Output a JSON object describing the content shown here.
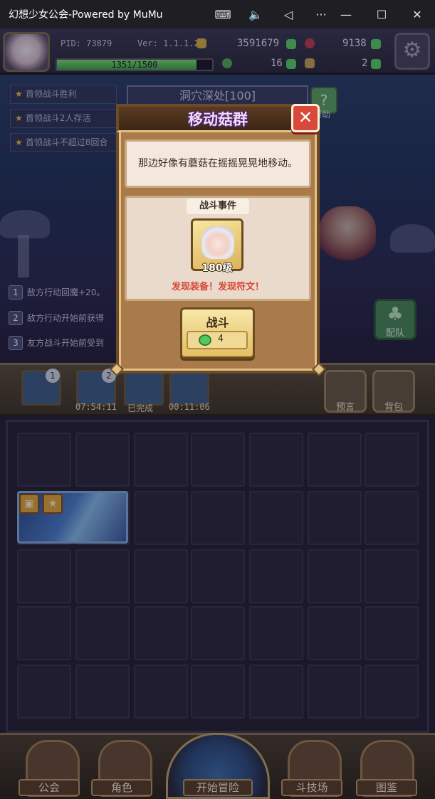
{
  "window": {
    "title": "幻想少女公会-Powered by MuMu",
    "icons": [
      "keyboard-icon",
      "volume-icon",
      "back-icon",
      "more-icon"
    ],
    "controls": [
      "minimize-icon",
      "maximize-icon",
      "close-icon"
    ]
  },
  "hud": {
    "pid": "PID: 73879",
    "version": "Ver: 1.1.1.2",
    "gold": "3591679",
    "gems": "9138",
    "clovers": "16",
    "keys": "2",
    "xp": {
      "text": "1351/1500",
      "fraction": 0.9
    }
  },
  "scene": {
    "goals": [
      "首领战斗胜利",
      "首领战斗2人存活",
      "首领战斗不超过8回合"
    ],
    "dungeon_name": "洞穴深处[100]",
    "help_label": "帮助",
    "rules": [
      {
        "num": "1",
        "text": "敌方行动回魔+20。"
      },
      {
        "num": "2",
        "text": "敌方行动开始前获得"
      },
      {
        "num": "3",
        "text": "友方战斗开始前受到"
      }
    ],
    "team_label": "配队"
  },
  "tray": {
    "slots": [
      {
        "badge": "1",
        "time": ""
      },
      {
        "badge": "2",
        "time": "07:54:11"
      },
      {
        "badge": "",
        "time": "已完成"
      },
      {
        "badge": "",
        "time": "00:11:06"
      }
    ],
    "prophecy_label": "预言",
    "bag_label": "背包"
  },
  "nav": {
    "guild": "公会",
    "character": "角色",
    "adventure": "开始冒险",
    "arena": "斗技场",
    "codex": "图鉴"
  },
  "modal": {
    "title": "移动菇群",
    "close": "✕",
    "description": "那边好像有蘑菇在摇摇晃晃地移动。",
    "event_title": "战斗事件",
    "hero_level": "180级",
    "discover": "发现装备！发现符文！",
    "fight_label": "战斗",
    "fight_cost": "4"
  },
  "colors": {
    "modal_frame": "#a97a4a",
    "title_purple": "#f3d7ff",
    "discover_red": "#d8473a",
    "button_gold": "#e3be64"
  }
}
